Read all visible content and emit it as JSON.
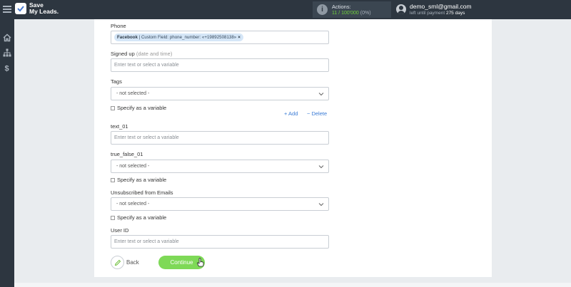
{
  "header": {
    "logo_line1": "Save",
    "logo_line2": "My Leads.",
    "actions_label": "Actions:",
    "actions_used": "11",
    "actions_total": "/ 100'000",
    "actions_percent": "(0%)",
    "user_email": "demo_sml@gmail.com",
    "payment_prefix": "left until payment",
    "payment_days": "275 days"
  },
  "sidebar": {
    "icons": [
      "home-icon",
      "sitemap-icon",
      "dollar-icon"
    ]
  },
  "form": {
    "phone": {
      "label": "Phone",
      "tag_source": "Facebook",
      "tag_text": "| Custom Field: phone_number: «+19892508138»",
      "tag_remove": "×"
    },
    "signed_up": {
      "label": "Signed up",
      "hint": "(date and time)",
      "placeholder": "Enter text or select a variable"
    },
    "tags": {
      "label": "Tags",
      "selected": "- not selected -",
      "variable_label": "Specify as a variable",
      "add_label": "+ Add",
      "delete_label": "− Delete"
    },
    "text_01": {
      "label": "text_01",
      "placeholder": "Enter text or select a variable"
    },
    "true_false_01": {
      "label": "true_false_01",
      "selected": "- not selected -",
      "variable_label": "Specify as a variable"
    },
    "unsubscribed": {
      "label": "Unsubscribed from Emails",
      "selected": "- not selected -",
      "variable_label": "Specify as a variable"
    },
    "user_id": {
      "label": "User ID",
      "placeholder": "Enter text or select a variable"
    }
  },
  "buttons": {
    "back_label": "Back",
    "continue_label": "Continue"
  },
  "colors": {
    "topbar": "#2d3640",
    "accent_green": "#7ed957",
    "link_blue": "#3a7bd5",
    "tag_bg": "#d5e6f7"
  }
}
